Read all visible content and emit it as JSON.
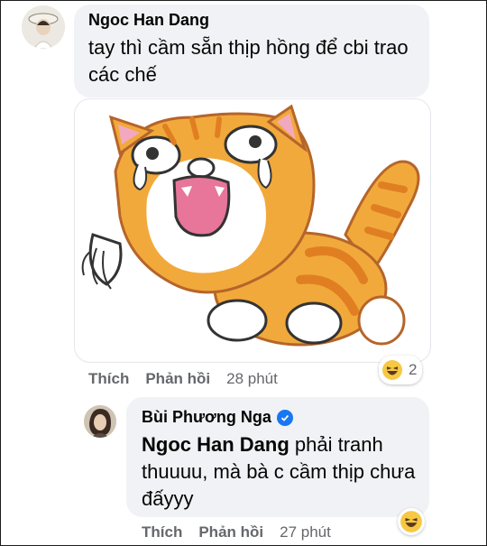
{
  "comments": [
    {
      "author": "Ngoc Han Dang",
      "text": "tay thì cầm sẵn thịp hồng để cbi trao các chế",
      "actions": {
        "like": "Thích",
        "reply": "Phản hồi"
      },
      "time": "28 phút",
      "reaction": {
        "icon": "haha-emoji-icon",
        "count": "2"
      }
    },
    {
      "author": "Bùi Phương Nga",
      "verified": true,
      "mention": "Ngoc Han Dang",
      "text": " phải tranh thuuuu, mà bà c cầm thịp chưa đấyyy",
      "actions": {
        "like": "Thích",
        "reply": "Phản hồi"
      },
      "time": "27 phút",
      "reaction": {
        "icon": "haha-emoji-icon"
      }
    }
  ],
  "colors": {
    "bubble": "#f0f2f5",
    "meta_text": "#65676b",
    "verified": "#1877f2",
    "cat_orange": "#f2a93b"
  }
}
